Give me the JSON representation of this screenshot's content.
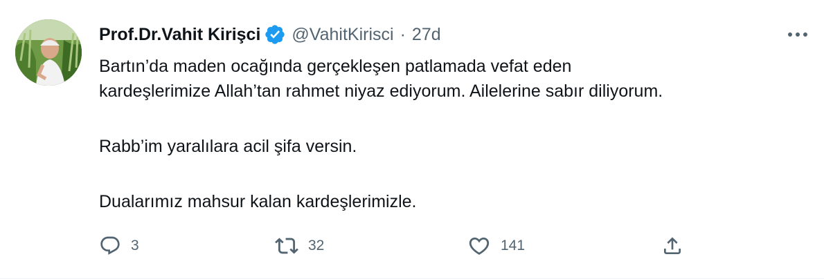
{
  "tweet": {
    "author": {
      "display_name": "Prof.Dr.Vahit Kirişci",
      "handle": "@VahitKirisci",
      "verified_icon": "verified-badge-icon",
      "avatar": "avatar"
    },
    "separator": "·",
    "time": "27d",
    "more_icon": "more-icon",
    "paragraphs": [
      "Bartın’da maden ocağında gerçekleşen patlamada vefat eden",
      "kardeşlerimize Allah’tan rahmet niyaz ediyorum. Ailelerine sabır diliyorum.",
      "Rabb’im yaralılara acil şifa versin.",
      "Dualarımız mahsur kalan kardeşlerimizle."
    ],
    "actions": {
      "reply": {
        "icon": "reply-icon",
        "count": "3"
      },
      "retweet": {
        "icon": "retweet-icon",
        "count": "32"
      },
      "like": {
        "icon": "heart-icon",
        "count": "141"
      },
      "share": {
        "icon": "share-icon"
      }
    }
  },
  "colors": {
    "text_primary": "#0f1419",
    "text_secondary": "#536471",
    "verified": "#1d9bf0",
    "divider": "#eff3f4"
  }
}
